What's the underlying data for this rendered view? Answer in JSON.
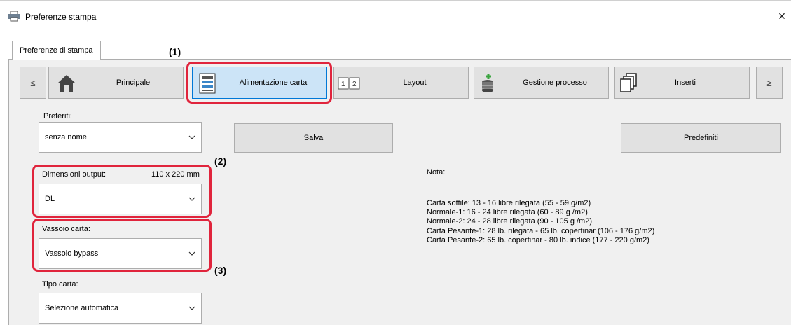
{
  "window": {
    "title": "Preferenze stampa",
    "close_label": "×"
  },
  "tabs": [
    {
      "label": "Preferenze di stampa"
    }
  ],
  "nav": {
    "prev_label": "≤",
    "next_label": "≥",
    "items": [
      {
        "label": "Principale",
        "icon": "home-icon"
      },
      {
        "label": "Alimentazione carta",
        "icon": "paper-tray-icon"
      },
      {
        "label": "Layout",
        "icon": "layout-icon"
      },
      {
        "label": "Gestione processo",
        "icon": "job-stack-icon"
      },
      {
        "label": "Inserti",
        "icon": "pages-icon"
      }
    ],
    "selected": "Alimentazione carta"
  },
  "favorites": {
    "label": "Preferiti:",
    "value": "senza nome",
    "save_label": "Salva",
    "defaults_label": "Predefiniti"
  },
  "output_size": {
    "label": "Dimensioni output:",
    "value_mm": "110 x 220 mm",
    "selected": "DL"
  },
  "paper_tray": {
    "label": "Vassoio carta:",
    "selected": "Vassoio bypass"
  },
  "paper_type": {
    "label": "Tipo carta:",
    "selected": "Selezione automatica"
  },
  "note": {
    "title": "Nota:",
    "lines": [
      "Carta sottile: 13 - 16 libre rilegata (55 - 59 g/m2)",
      "Normale-1: 16 - 24 libre rilegata (60 - 89 g /m2)",
      "Normale-2: 24 - 28 libre rilegata (90 - 105 g /m2)",
      "Carta Pesante-1: 28 lb. rilegata - 65 lb. copertinar (106 - 176 g/m2)",
      "Carta Pesante-2: 65 lb. copertinar - 80 lb. indice (177 - 220 g/m2)"
    ]
  },
  "callouts": {
    "c1": "(1)",
    "c2": "(2)",
    "c3": "(3)"
  },
  "colors": {
    "callout": "#e0243c",
    "selected_bg": "#cce4f7",
    "selected_border": "#0078d7"
  }
}
